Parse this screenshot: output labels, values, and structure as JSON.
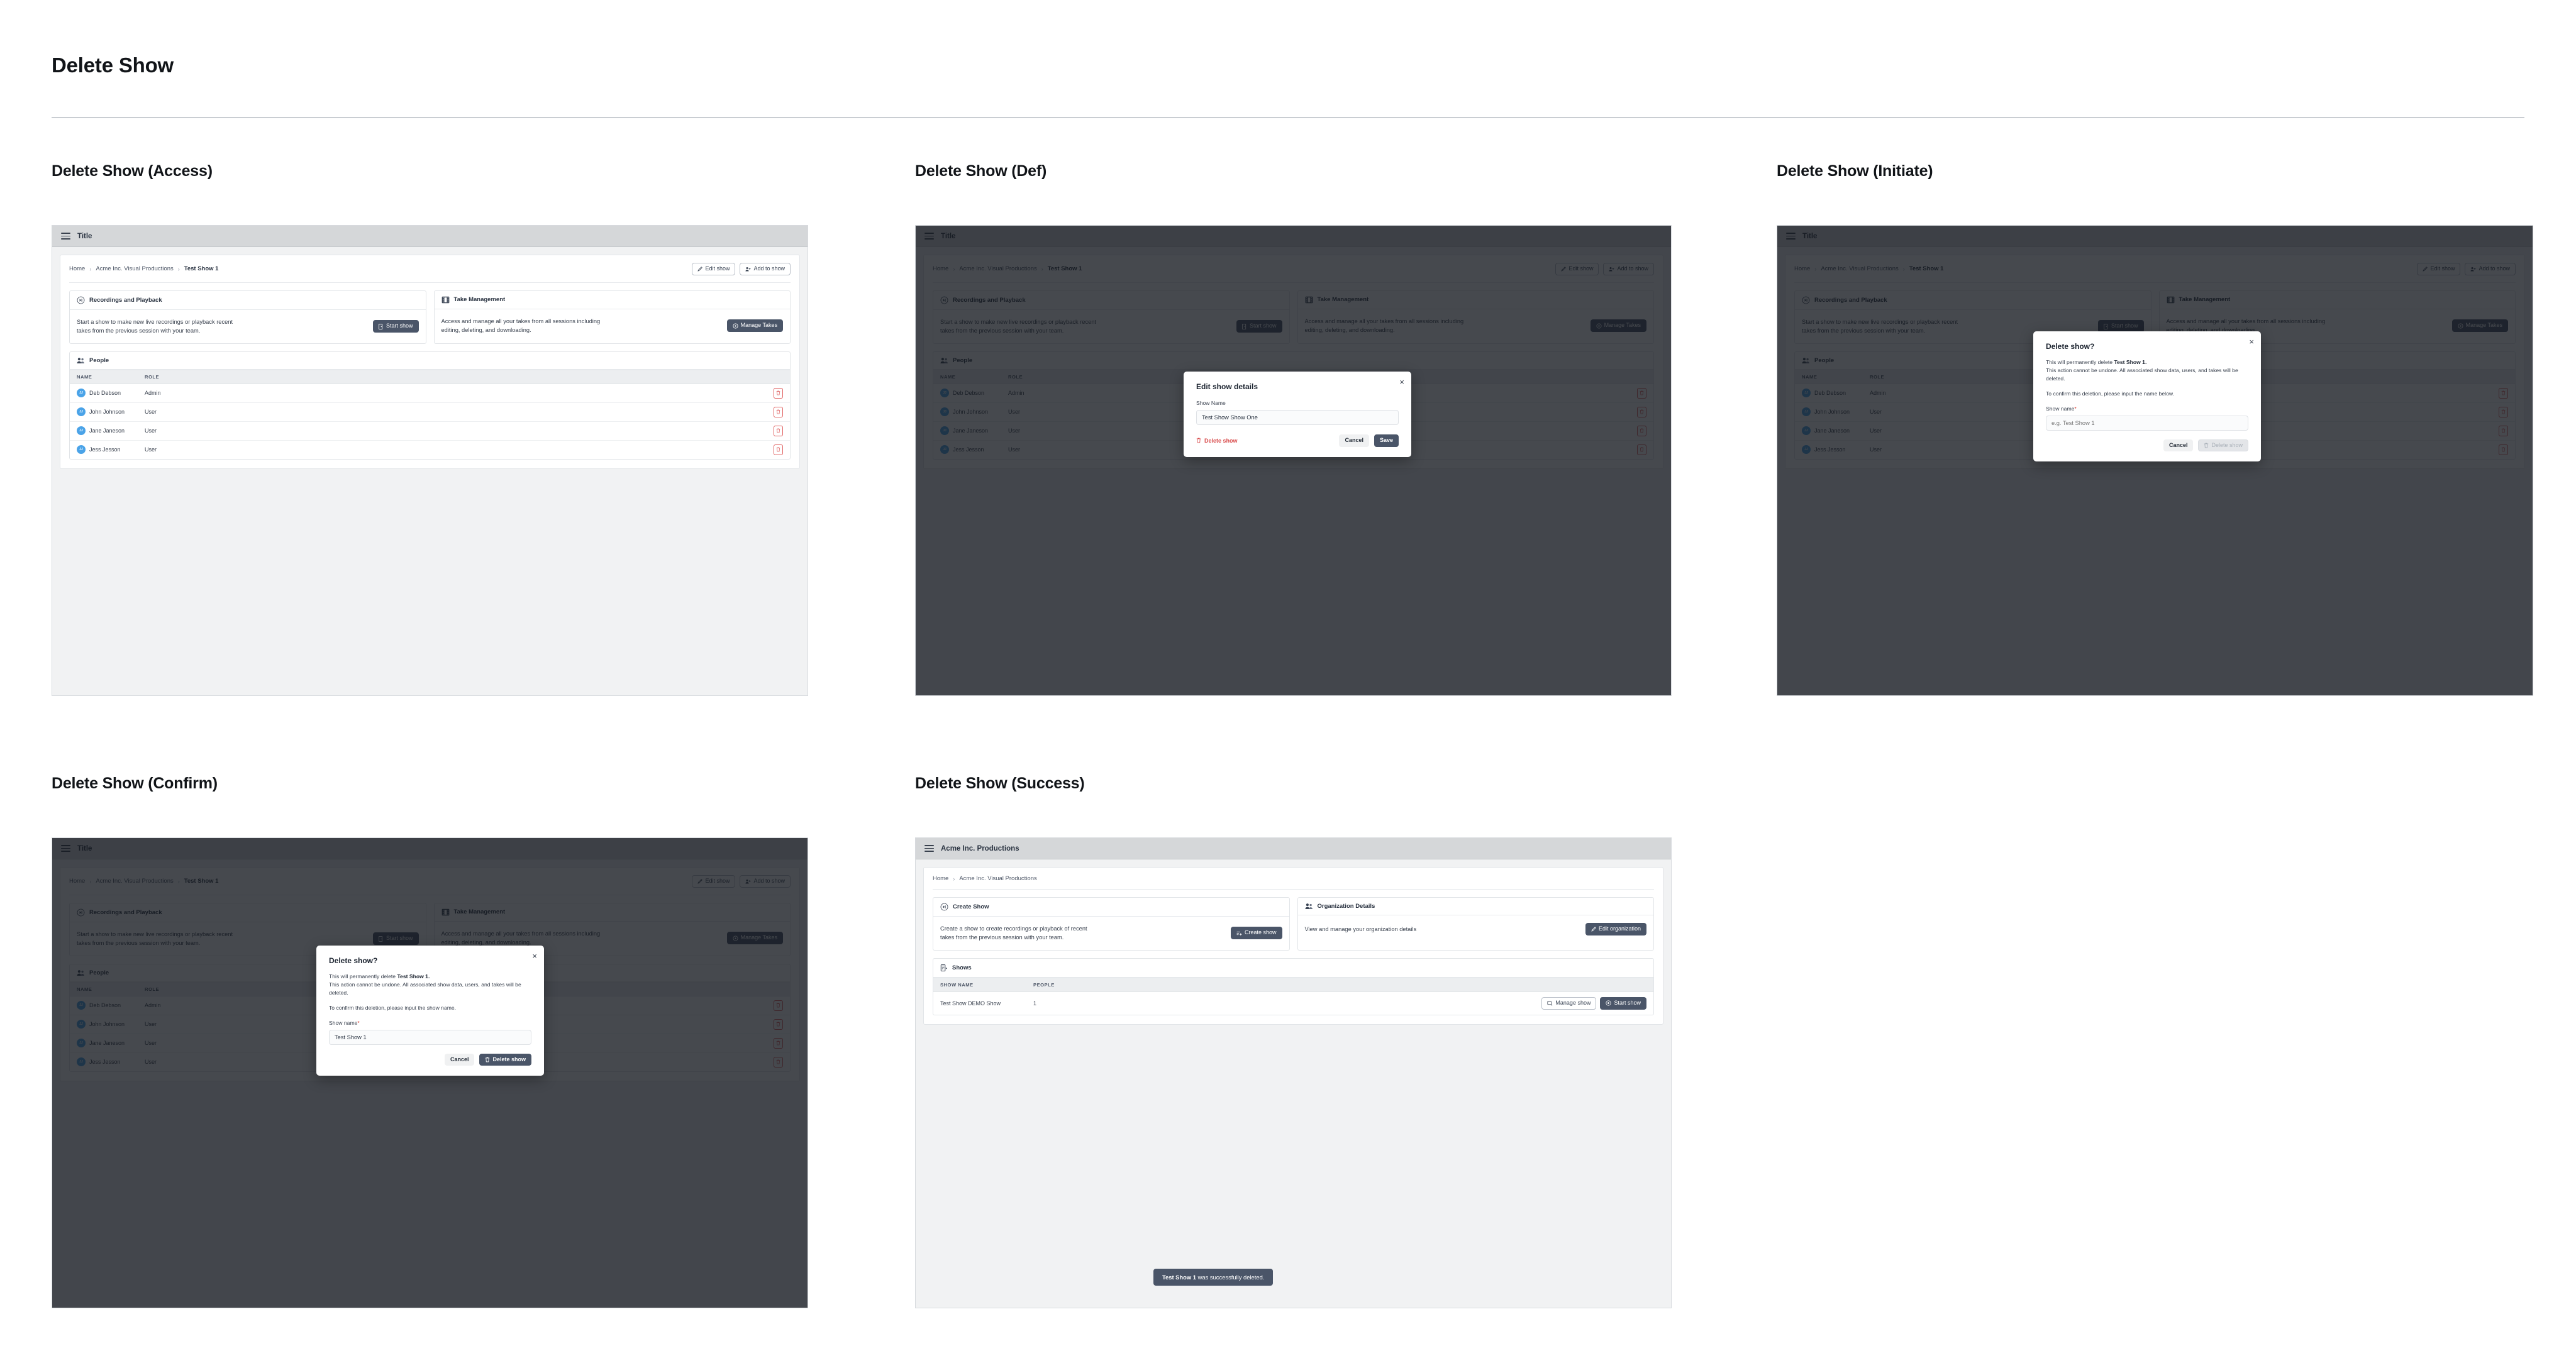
{
  "page": {
    "title": "Delete Show"
  },
  "sections": [
    {
      "key": "access",
      "heading": "Delete Show (Access)"
    },
    {
      "key": "def",
      "heading": "Delete Show (Def)"
    },
    {
      "key": "initiate",
      "heading": "Delete Show (Initiate)"
    },
    {
      "key": "confirm",
      "heading": "Delete Show (Confirm)"
    },
    {
      "key": "success",
      "heading": "Delete Show (Success)"
    }
  ],
  "app": {
    "topbar_title": "Title",
    "topbar_title_org": "Acme Inc. Productions",
    "breadcrumb": {
      "home": "Home",
      "org": "Acme Inc. Visual Productions",
      "current": "Test Show 1"
    },
    "breadcrumb_separator": "›",
    "actions": {
      "edit_show": "Edit show",
      "add_to_show": "Add to show"
    },
    "cards": {
      "recordings": {
        "title": "Recordings and Playback",
        "body": "Start a show to make new live recordings or playback recent takes from the previous session with your team.",
        "button": "Start show"
      },
      "takes": {
        "title": "Take Management",
        "body": "Access and manage all your takes from all sessions including editing, deleting, and downloading.",
        "button": "Manage Takes"
      }
    },
    "people": {
      "title": "People",
      "columns": [
        "NAME",
        "ROLE"
      ],
      "rows": [
        {
          "initials": "JJ",
          "name": "Deb Debson",
          "role": "Admin"
        },
        {
          "initials": "JJ",
          "name": "John Johnson",
          "role": "User"
        },
        {
          "initials": "JJ",
          "name": "Jane Janeson",
          "role": "User"
        },
        {
          "initials": "JJ",
          "name": "Jess Jesson",
          "role": "User"
        }
      ]
    }
  },
  "org_app": {
    "breadcrumb": {
      "home": "Home",
      "org": "Acme Inc. Visual Productions"
    },
    "cards": {
      "create": {
        "title": "Create Show",
        "body": "Create a show to create recordings or playback of recent takes from the previous session with your team.",
        "button": "Create show"
      },
      "organization": {
        "title": "Organization Details",
        "body": "View and manage your organization details",
        "button": "Edit organization"
      }
    },
    "shows": {
      "title": "Shows",
      "columns": [
        "SHOW NAME",
        "PEOPLE"
      ],
      "rows": [
        {
          "name": "Test Show DEMO Show",
          "people": "1",
          "manage": "Manage show",
          "start": "Start show"
        }
      ]
    },
    "toast": {
      "bold": "Test Show 1",
      "rest": " was successfully deleted."
    }
  },
  "edit_modal": {
    "title": "Edit show details",
    "field_label": "Show Name",
    "value": "Test Show Show One",
    "delete_link": "Delete show",
    "cancel": "Cancel",
    "save": "Save",
    "close": "×"
  },
  "delete_modal_initiate": {
    "title": "Delete show?",
    "line1_prefix": "This will permanently delete ",
    "line1_bold": "Test Show 1.",
    "line2": "This action cannot be undone. All associated show data, users, and takes will be deleted.",
    "line3": "To confirm this deletion, please input the name below.",
    "field_label": "Show name",
    "required_mark": "*",
    "placeholder": "e.g. Test Show 1",
    "value": "",
    "cancel": "Cancel",
    "delete": "Delete show",
    "delete_enabled": false,
    "close": "×"
  },
  "delete_modal_confirm": {
    "title": "Delete show?",
    "line1_prefix": "This will permanently delete ",
    "line1_bold": "Test Show 1.",
    "line2": "This action cannot be undone. All associated show data, users, and takes will be deleted.",
    "line3": "To confirm this deletion, please input the show name.",
    "field_label": "Show name",
    "required_mark": "*",
    "placeholder": "e.g. Test Show 1",
    "value": "Test Show 1",
    "cancel": "Cancel",
    "delete": "Delete show",
    "delete_enabled": true,
    "close": "×"
  },
  "colors": {
    "accent_dark": "#4a5568",
    "danger": "#d94c4c",
    "required": "#d93025",
    "avatar": "#4aa3e8",
    "topbar": "#d5d7d9",
    "frame_bg": "#f1f2f3"
  }
}
